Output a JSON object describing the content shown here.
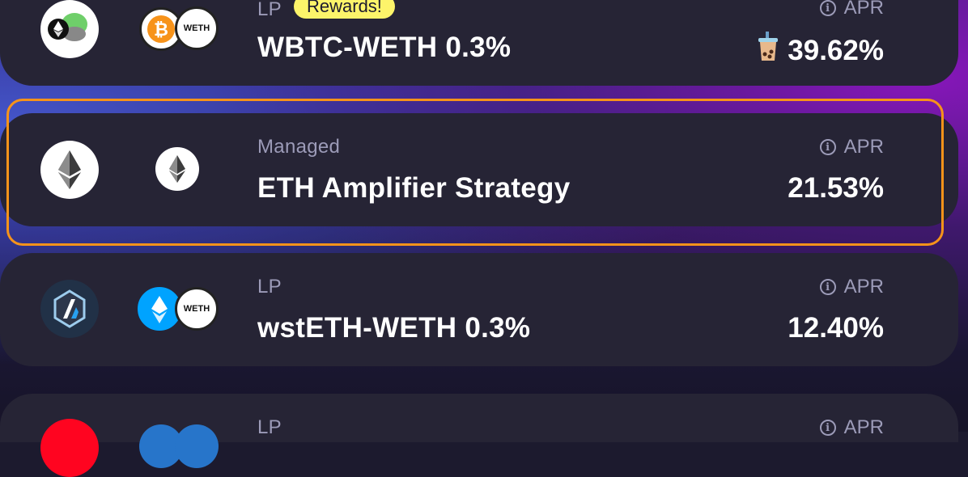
{
  "pools": [
    {
      "type_label": "LP",
      "badge": "Rewards!",
      "name": "WBTC-WETH 0.3%",
      "apr_label": "APR",
      "apr_value": "39.62%",
      "token_b_text": "WETH",
      "token_a_glyph": "₿"
    },
    {
      "type_label": "Managed",
      "name": "ETH Amplifier Strategy",
      "apr_label": "APR",
      "apr_value": "21.53%"
    },
    {
      "type_label": "LP",
      "name": "wstETH-WETH 0.3%",
      "apr_label": "APR",
      "apr_value": "12.40%",
      "token_b_text": "WETH"
    },
    {
      "type_label": "LP",
      "apr_label": "APR"
    }
  ],
  "colors": {
    "highlight": "#f7931a",
    "badge": "#fdf46a",
    "card": "#262435"
  }
}
